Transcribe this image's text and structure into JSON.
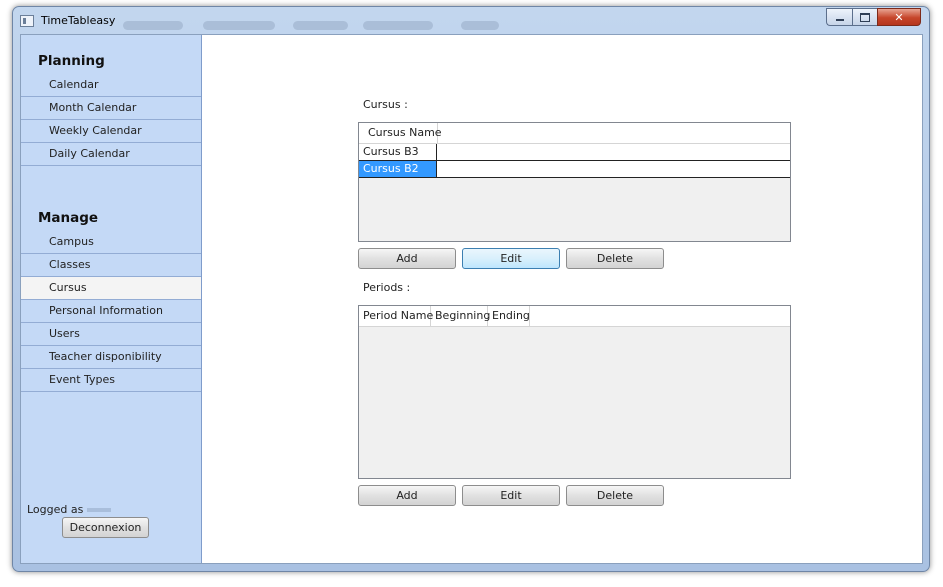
{
  "window": {
    "title": "TimeTableasy",
    "controls": {
      "minimize": "",
      "maximize": "",
      "close": "✕"
    }
  },
  "sidebar": {
    "planning_title": "Planning",
    "planning_items": [
      {
        "label": "Calendar"
      },
      {
        "label": "Month Calendar"
      },
      {
        "label": "Weekly Calendar"
      },
      {
        "label": "Daily Calendar"
      }
    ],
    "manage_title": "Manage",
    "manage_items": [
      {
        "label": "Campus"
      },
      {
        "label": "Classes"
      },
      {
        "label": "Cursus",
        "active": true
      },
      {
        "label": "Personal Information"
      },
      {
        "label": "Users"
      },
      {
        "label": "Teacher disponibility"
      },
      {
        "label": "Event Types"
      }
    ],
    "logged_label": "Logged as",
    "logout_button": "Deconnexion"
  },
  "cursus": {
    "label": "Cursus :",
    "columns": [
      "Cursus Name"
    ],
    "rows": [
      {
        "name": "Cursus B3",
        "selected": false
      },
      {
        "name": "Cursus B2",
        "selected": true
      }
    ],
    "buttons": {
      "add": "Add",
      "edit": "Edit",
      "delete": "Delete"
    }
  },
  "periods": {
    "label": "Periods :",
    "columns": [
      "Period Name",
      "Beginning",
      "Ending"
    ],
    "rows": [],
    "buttons": {
      "add": "Add",
      "edit": "Edit",
      "delete": "Delete"
    }
  },
  "colors": {
    "sidebar_bg": "#c4d9f6",
    "selection": "#3399ff",
    "frame": "#a9c1e2"
  }
}
